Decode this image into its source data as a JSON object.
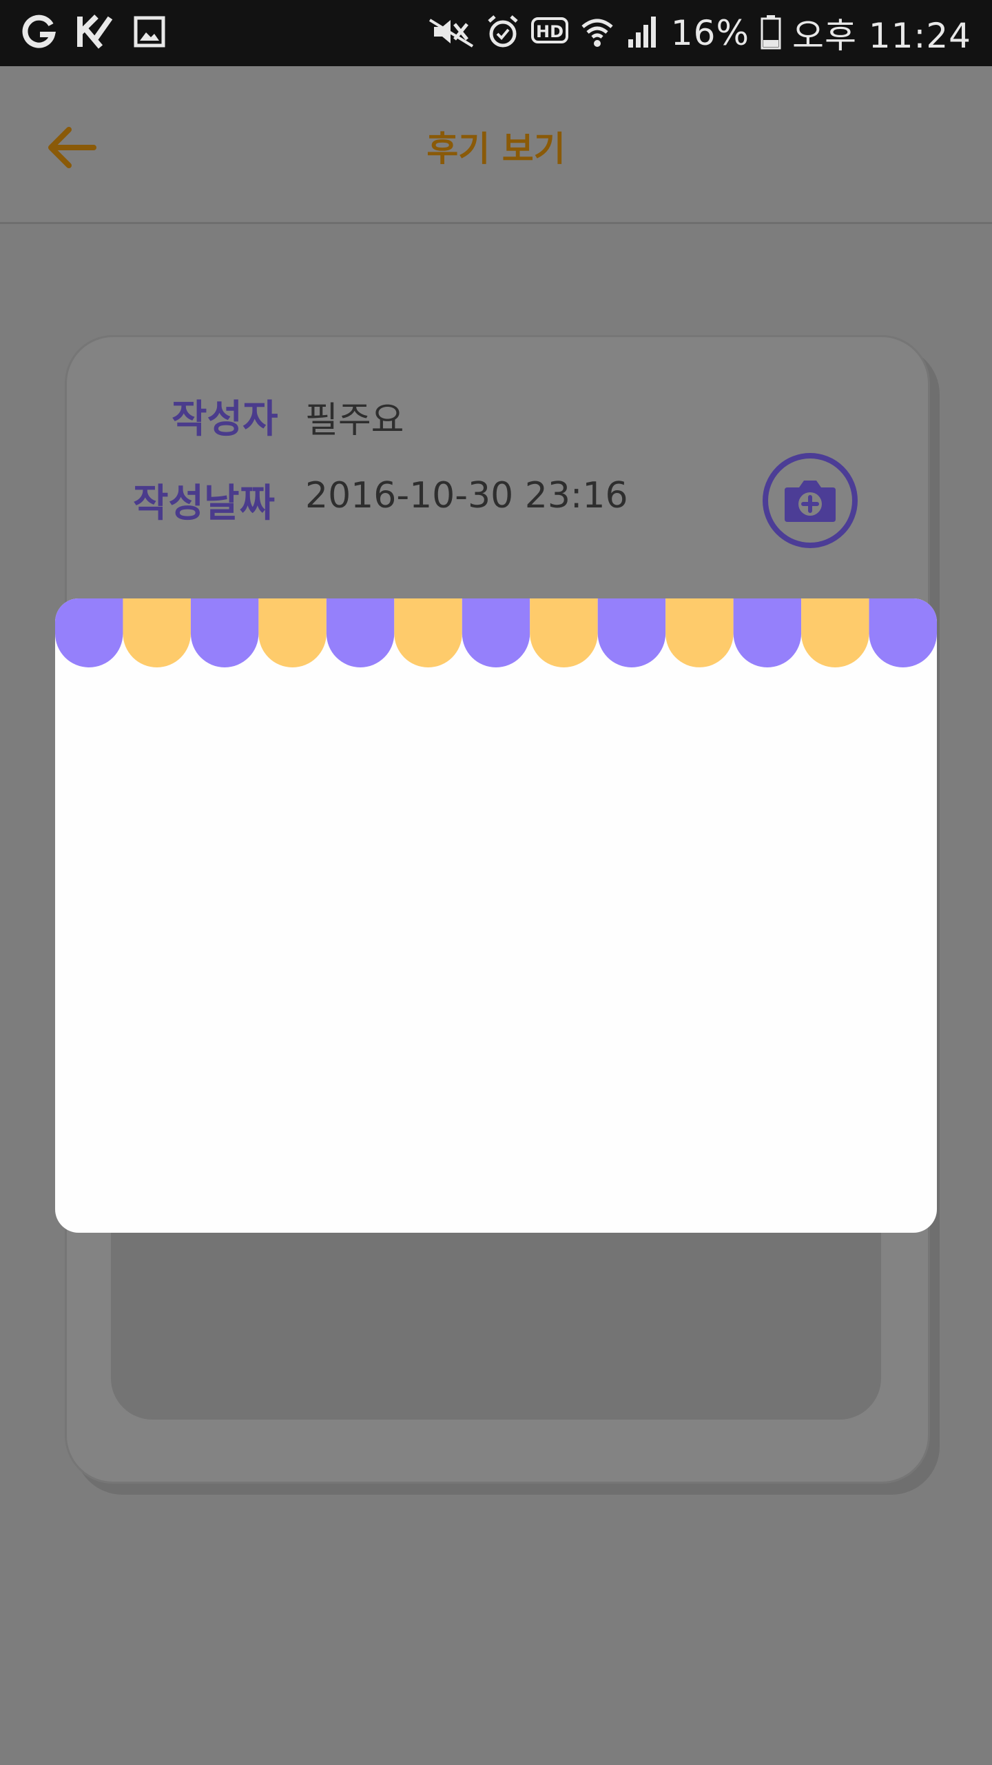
{
  "status_bar": {
    "battery": "16%",
    "time": "오후 11:24",
    "left_icons": [
      "notification-g-icon",
      "notification-k-icon",
      "gallery-icon"
    ],
    "right_icons": [
      "mute-icon",
      "alarm-icon",
      "hd-icon",
      "wifi-icon",
      "signal-icon",
      "battery-icon"
    ]
  },
  "header": {
    "title": "후기 보기",
    "back_icon": "arrow-left-icon",
    "accent_color": "#8a5a08"
  },
  "review": {
    "author_label": "작성자",
    "author_value": "필주요",
    "date_label": "작성날짜",
    "date_value": "2016-10-30 23:16",
    "camera_icon": "camera-plus-icon",
    "label_color": "#4a3b8c"
  },
  "popup": {
    "awning_colors": [
      "#9580fb",
      "#fecb6b"
    ],
    "background": "#fefefe"
  }
}
